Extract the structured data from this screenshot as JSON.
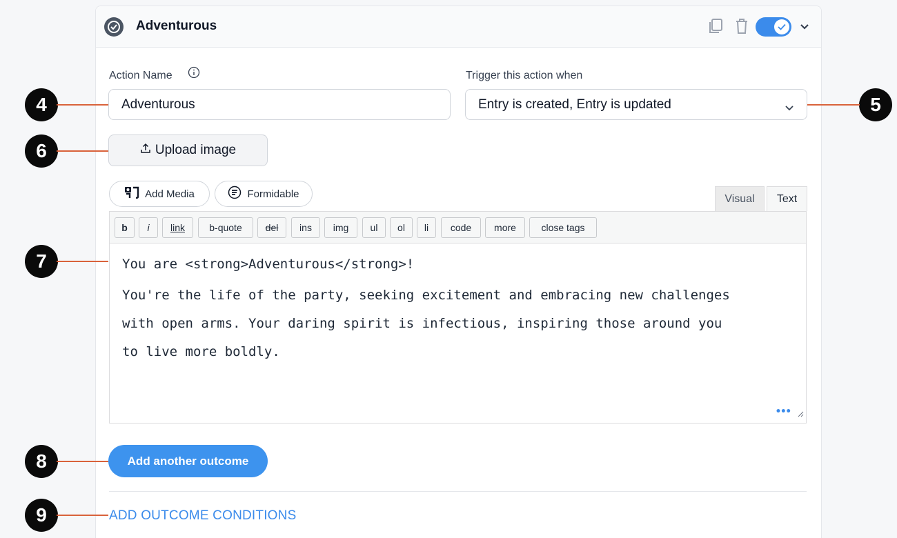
{
  "header": {
    "title": "Adventurous",
    "duplicate_icon": "duplicate-icon",
    "delete_icon": "trash-icon",
    "toggle_state": "on",
    "expand_icon": "chevron-down-icon"
  },
  "action_name": {
    "label": "Action Name",
    "value": "Adventurous",
    "info_icon": "info-icon"
  },
  "trigger": {
    "label": "Trigger this action when",
    "value": "Entry is created, Entry is updated"
  },
  "upload": {
    "label": "Upload image",
    "icon": "upload-icon"
  },
  "media_buttons": {
    "add_media": "Add Media",
    "formidable": "Formidable"
  },
  "editor": {
    "tabs": [
      "Visual",
      "Text"
    ],
    "active_tab": "Text",
    "toolbar": [
      "b",
      "i",
      "link",
      "b-quote",
      "del",
      "ins",
      "img",
      "ul",
      "ol",
      "li",
      "code",
      "more",
      "close tags"
    ],
    "lines": [
      "You are <strong>Adventurous</strong>!",
      "You're the life of the party, seeking excitement and embracing new challenges",
      "with open arms. Your daring spirit is infectious, inspiring those around you",
      "to live more boldly."
    ]
  },
  "add_outcome_button": "Add another outcome",
  "conditions_link": "ADD OUTCOME CONDITIONS",
  "callouts": [
    "4",
    "5",
    "6",
    "7",
    "8",
    "9"
  ],
  "colors": {
    "accent": "#3b8beb",
    "callout_line": "#d9623b",
    "callout_fill": "#0a0a0a"
  }
}
